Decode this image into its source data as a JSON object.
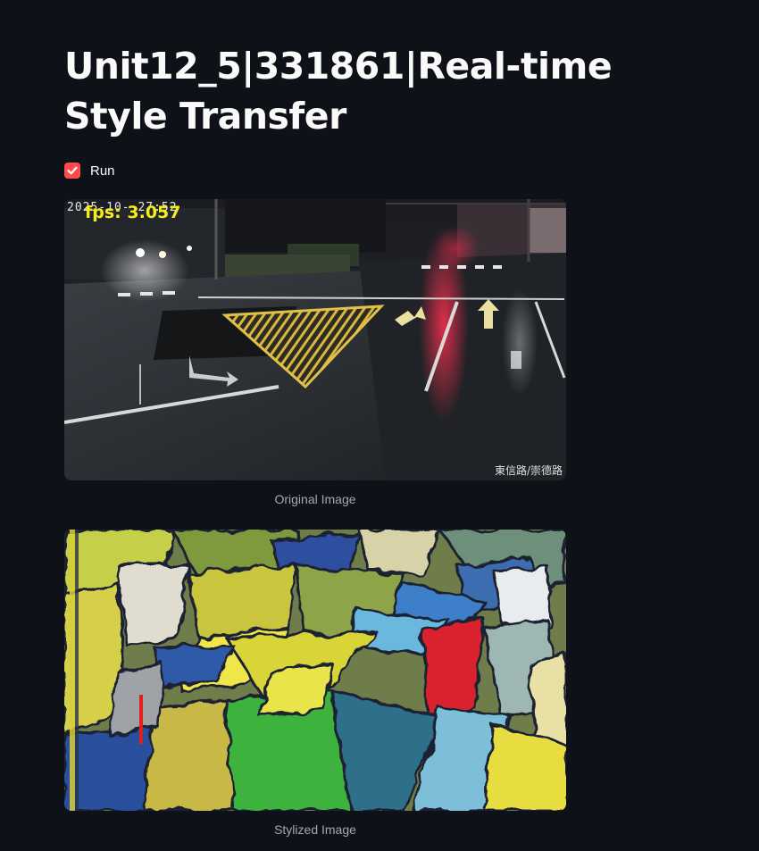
{
  "page": {
    "title": "Unit12_5|331861|Real-time Style Transfer"
  },
  "controls": {
    "run_label": "Run",
    "run_checked": true,
    "accent_color": "#ff4b4b"
  },
  "original_image": {
    "caption": "Original Image",
    "timestamp": "2025-10-  27:52",
    "fps_text": "fps: 3.057",
    "camera_label": "東信路/崇德路"
  },
  "stylized_image": {
    "caption": "Stylized Image"
  }
}
